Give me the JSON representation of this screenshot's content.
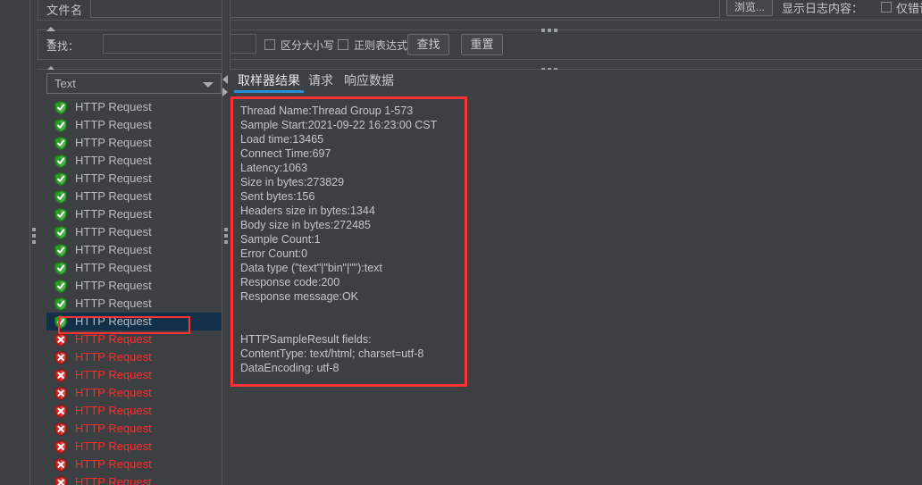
{
  "toolbar": {
    "filename_label": "文件名",
    "filename_value": "",
    "browse_button": "浏览...",
    "show_log_label": "显示日志内容：",
    "error_only_label": "仅错误日志"
  },
  "search": {
    "find_label": "查找：",
    "find_value": "",
    "case_sensitive_label": "区分大小写",
    "regex_label": "正则表达式",
    "find_button": "查找",
    "reset_button": "重置"
  },
  "tree": {
    "view_mode": "Text",
    "rows": [
      {
        "label": "HTTP Request",
        "status": "ok",
        "selected": false
      },
      {
        "label": "HTTP Request",
        "status": "ok",
        "selected": false
      },
      {
        "label": "HTTP Request",
        "status": "ok",
        "selected": false
      },
      {
        "label": "HTTP Request",
        "status": "ok",
        "selected": false
      },
      {
        "label": "HTTP Request",
        "status": "ok",
        "selected": false
      },
      {
        "label": "HTTP Request",
        "status": "ok",
        "selected": false
      },
      {
        "label": "HTTP Request",
        "status": "ok",
        "selected": false
      },
      {
        "label": "HTTP Request",
        "status": "ok",
        "selected": false
      },
      {
        "label": "HTTP Request",
        "status": "ok",
        "selected": false
      },
      {
        "label": "HTTP Request",
        "status": "ok",
        "selected": false
      },
      {
        "label": "HTTP Request",
        "status": "ok",
        "selected": false
      },
      {
        "label": "HTTP Request",
        "status": "ok",
        "selected": false
      },
      {
        "label": "HTTP Request",
        "status": "ok",
        "selected": true
      },
      {
        "label": "HTTP Request",
        "status": "error",
        "selected": false
      },
      {
        "label": "HTTP Request",
        "status": "error",
        "selected": false
      },
      {
        "label": "HTTP Request",
        "status": "error",
        "selected": false
      },
      {
        "label": "HTTP Request",
        "status": "error",
        "selected": false
      },
      {
        "label": "HTTP Request",
        "status": "error",
        "selected": false
      },
      {
        "label": "HTTP Request",
        "status": "error",
        "selected": false
      },
      {
        "label": "HTTP Request",
        "status": "error",
        "selected": false
      },
      {
        "label": "HTTP Request",
        "status": "error",
        "selected": false
      },
      {
        "label": "HTTP Request",
        "status": "error",
        "selected": false
      }
    ]
  },
  "results": {
    "tabs": [
      {
        "label": "取样器结果",
        "active": true
      },
      {
        "label": "请求",
        "active": false
      },
      {
        "label": "响应数据",
        "active": false
      }
    ],
    "lines": [
      "Thread Name:Thread Group 1-573",
      "Sample Start:2021-09-22 16:23:00 CST",
      "Load time:13465",
      "Connect Time:697",
      "Latency:1063",
      "Size in bytes:273829",
      "Sent bytes:156",
      "Headers size in bytes:1344",
      "Body size in bytes:272485",
      "Sample Count:1",
      "Error Count:0",
      "Data type (\"text\"|\"bin\"|\"\"):text",
      "Response code:200",
      "Response message:OK",
      "",
      "",
      "HTTPSampleResult fields:",
      "ContentType: text/html; charset=utf-8",
      "DataEncoding: utf-8"
    ]
  },
  "colors": {
    "background": "#3c4043",
    "accent": "#2a8bd6",
    "annotation": "#ff3333",
    "selection": "#123049",
    "ok": "#2aa02a",
    "error": "#cc2222",
    "error_text": "#ff2b2b"
  }
}
